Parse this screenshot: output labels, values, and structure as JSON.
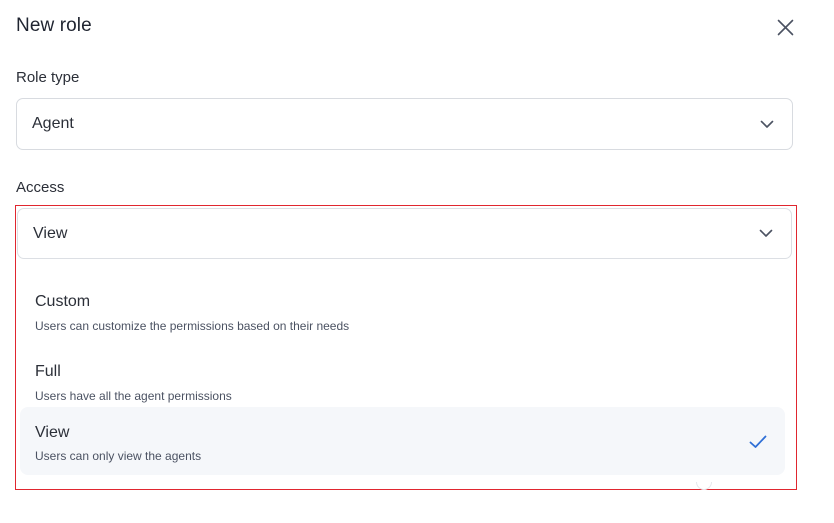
{
  "dialog": {
    "title": "New role",
    "close_icon": "close-icon"
  },
  "role_type": {
    "label": "Role type",
    "value": "Agent",
    "icon": "chevron-down-icon"
  },
  "access": {
    "label": "Access",
    "value": "View",
    "icon": "chevron-down-icon",
    "options": [
      {
        "title": "Custom",
        "description": "Users can customize the permissions based on their needs",
        "selected": false
      },
      {
        "title": "Full",
        "description": "Users have all the agent permissions",
        "selected": false
      },
      {
        "title": "View",
        "description": "Users can only view the agents",
        "selected": true
      }
    ]
  },
  "colors": {
    "highlight_border": "#e0262f",
    "check_accent": "#2f6fd6",
    "selected_bg": "#f5f7fa"
  }
}
